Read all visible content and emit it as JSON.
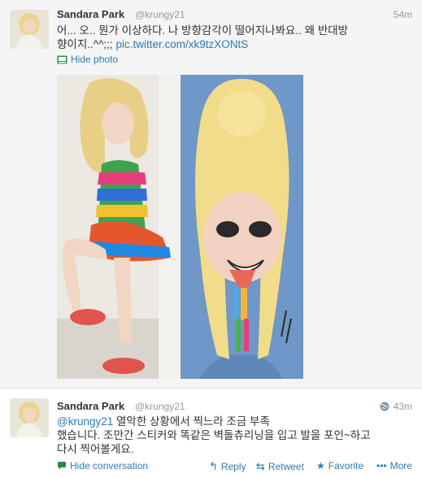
{
  "tweet1": {
    "name": "Sandara Park",
    "handle": "@krungy21",
    "time": "54m",
    "text_line1": "어... 오.. 뭔가 이상하다. 나 방향감각이 떨어지나봐요.. 왜 반대방",
    "text_line2": "향이지..^^;;;",
    "link": "pic.twitter.com/xk9tzXONtS",
    "hide_photo": "Hide photo"
  },
  "tweet2": {
    "name": "Sandara Park",
    "handle": "@krungy21",
    "time": "43m",
    "mention": "@krungy21",
    "text_line1_rest": " 열악한 상황에서 찍느라 조금 부족",
    "text_line2": "했습니다. 조만간 스티커와 똑같은 벽돌츄리닝을 입고 발을 포인~하고",
    "text_line3": "다시 찍어볼게요.",
    "hide_conversation": "Hide conversation",
    "reply": "Reply",
    "retweet": "Retweet",
    "favorite": "Favorite",
    "more": "More"
  },
  "colors": {
    "link": "#2b7bb9",
    "name": "#333333",
    "meta": "#999999"
  }
}
